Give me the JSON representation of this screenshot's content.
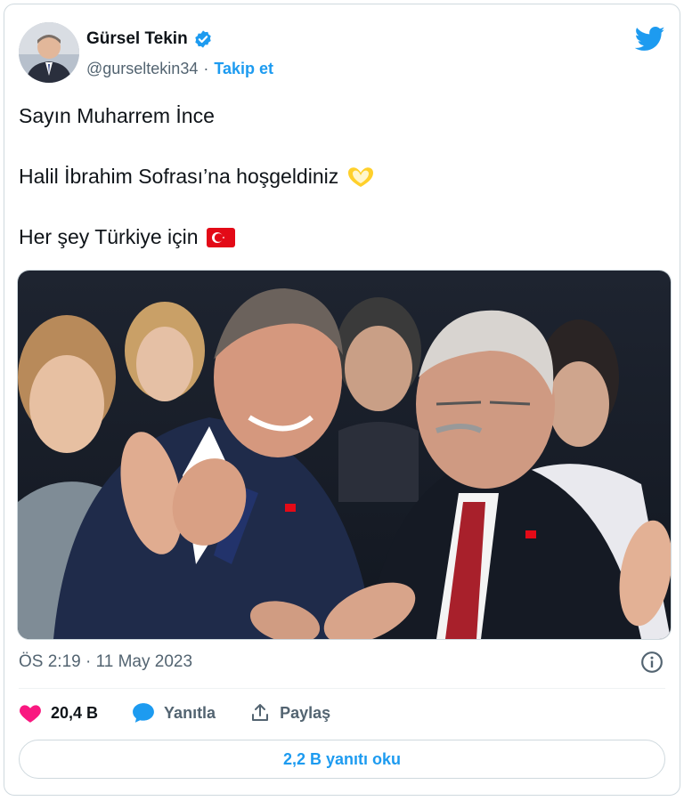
{
  "author": {
    "name": "Gürsel Tekin",
    "handle": "@gurseltekin34",
    "separator": "·",
    "follow_label": "Takip et",
    "verified_icon": "verified-badge-icon"
  },
  "brand": {
    "logo_icon": "twitter-bird-icon",
    "color": "#1d9bf0"
  },
  "tweet": {
    "line1": "Sayın Muharrem İnce",
    "line2": "Halil İbrahim Sofrası’na hoşgeldiniz",
    "line2_emoji": "heart-hands-icon",
    "line3": "Her şey Türkiye için",
    "line3_emoji": "turkey-flag-icon"
  },
  "media": {
    "icon": "photo-two-men-clapping"
  },
  "meta": {
    "timestamp": "ÖS 2:19 · 11 May 2023",
    "info_icon": "info-icon"
  },
  "actions": {
    "like_count": "20,4 B",
    "reply_label": "Yanıtla",
    "share_label": "Paylaş"
  },
  "read_replies_label": "2,2 B yanıtı oku",
  "colors": {
    "like": "#f91880",
    "link": "#1d9bf0",
    "muted": "#536471",
    "text": "#0f1419"
  }
}
